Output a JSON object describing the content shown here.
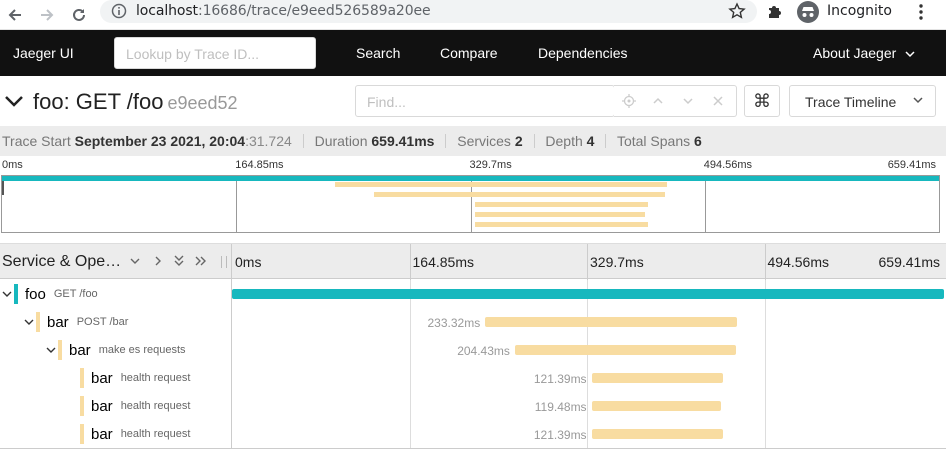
{
  "browser": {
    "url_host": "localhost",
    "url_rest": ":16686/trace/e9eed526589a20ee",
    "profile_label": "Incognito"
  },
  "nav": {
    "brand": "Jaeger UI",
    "lookup_placeholder": "Lookup by Trace ID...",
    "search": "Search",
    "compare": "Compare",
    "dependencies": "Dependencies",
    "about": "About Jaeger"
  },
  "trace": {
    "title": "foo: GET /foo",
    "trace_id_short": "e9eed52",
    "find_placeholder": "Find...",
    "keyboard_glyph": "⌘",
    "view_mode": "Trace Timeline"
  },
  "summary": {
    "trace_start_label": "Trace Start",
    "trace_start_date": "September 23 2021, 20:04",
    "trace_start_ms": ":31.724",
    "duration_label": "Duration",
    "duration_value": "659.41ms",
    "services_label": "Services",
    "services_value": "2",
    "depth_label": "Depth",
    "depth_value": "4",
    "total_spans_label": "Total Spans",
    "total_spans_value": "6"
  },
  "timeline": {
    "ticks": [
      "0ms",
      "164.85ms",
      "329.7ms",
      "494.56ms",
      "659.41ms"
    ],
    "column_title": "Service & Ope…",
    "total_ms": 659.41,
    "spans": [
      {
        "service": "foo",
        "operation": "GET /foo",
        "start_ms": 0,
        "duration_ms": 659.41,
        "duration_label": "",
        "color": "#17b8be",
        "depth": 0,
        "toggle": "collapse"
      },
      {
        "service": "bar",
        "operation": "POST /bar",
        "start_ms": 234.5,
        "duration_ms": 233.32,
        "duration_label": "233.32ms",
        "color": "#f8dca1",
        "depth": 1,
        "toggle": "collapse"
      },
      {
        "service": "bar",
        "operation": "make es requests",
        "start_ms": 262.0,
        "duration_ms": 204.43,
        "duration_label": "204.43ms",
        "color": "#f8dca1",
        "depth": 2,
        "toggle": "collapse"
      },
      {
        "service": "bar",
        "operation": "health request",
        "start_ms": 333.0,
        "duration_ms": 121.39,
        "duration_label": "121.39ms",
        "color": "#f8dca1",
        "depth": 3,
        "toggle": "none"
      },
      {
        "service": "bar",
        "operation": "health request",
        "start_ms": 333.0,
        "duration_ms": 119.48,
        "duration_label": "119.48ms",
        "color": "#f8dca1",
        "depth": 3,
        "toggle": "none"
      },
      {
        "service": "bar",
        "operation": "health request",
        "start_ms": 333.0,
        "duration_ms": 121.39,
        "duration_label": "121.39ms",
        "color": "#f8dca1",
        "depth": 3,
        "toggle": "none"
      }
    ]
  },
  "colors": {
    "root_service": "#17b8be",
    "bar_service": "#f8dca1",
    "nav_bg": "#111111"
  }
}
